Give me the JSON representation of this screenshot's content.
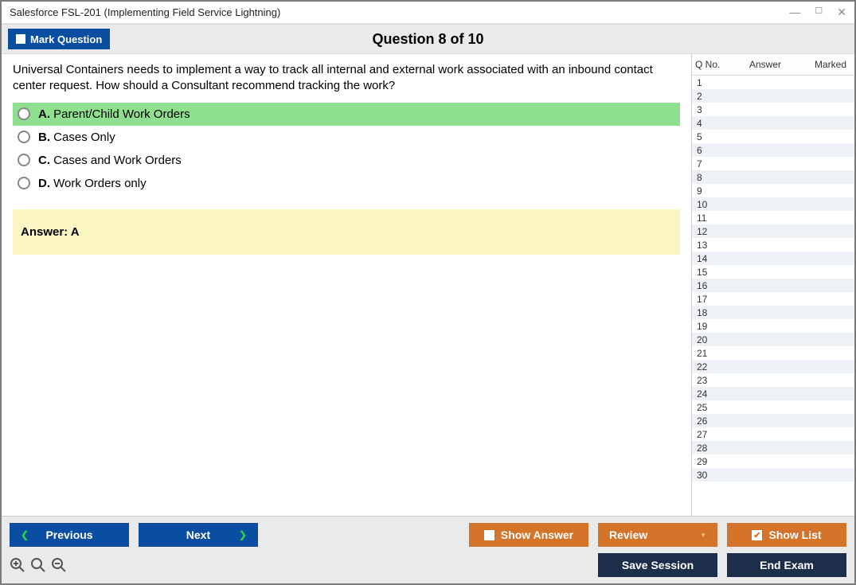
{
  "window": {
    "title": "Salesforce FSL-201 (Implementing Field Service Lightning)"
  },
  "toolbar": {
    "mark_label": "Mark Question",
    "question_title": "Question 8 of 10"
  },
  "question": {
    "text": "Universal Containers needs to implement a way to track all internal and external work associated with an inbound contact center request. How should a Consultant recommend tracking the work?",
    "options": [
      {
        "letter": "A.",
        "text": "Parent/Child Work Orders",
        "selected": true
      },
      {
        "letter": "B.",
        "text": "Cases Only",
        "selected": false
      },
      {
        "letter": "C.",
        "text": "Cases and Work Orders",
        "selected": false
      },
      {
        "letter": "D.",
        "text": "Work Orders only",
        "selected": false
      }
    ],
    "answer_label": "Answer: A"
  },
  "side": {
    "headers": {
      "qno": "Q No.",
      "answer": "Answer",
      "marked": "Marked"
    },
    "rows": [
      1,
      2,
      3,
      4,
      5,
      6,
      7,
      8,
      9,
      10,
      11,
      12,
      13,
      14,
      15,
      16,
      17,
      18,
      19,
      20,
      21,
      22,
      23,
      24,
      25,
      26,
      27,
      28,
      29,
      30
    ]
  },
  "footer": {
    "previous": "Previous",
    "next": "Next",
    "show_answer": "Show Answer",
    "review": "Review",
    "show_list": "Show List",
    "save_session": "Save Session",
    "end_exam": "End Exam"
  }
}
